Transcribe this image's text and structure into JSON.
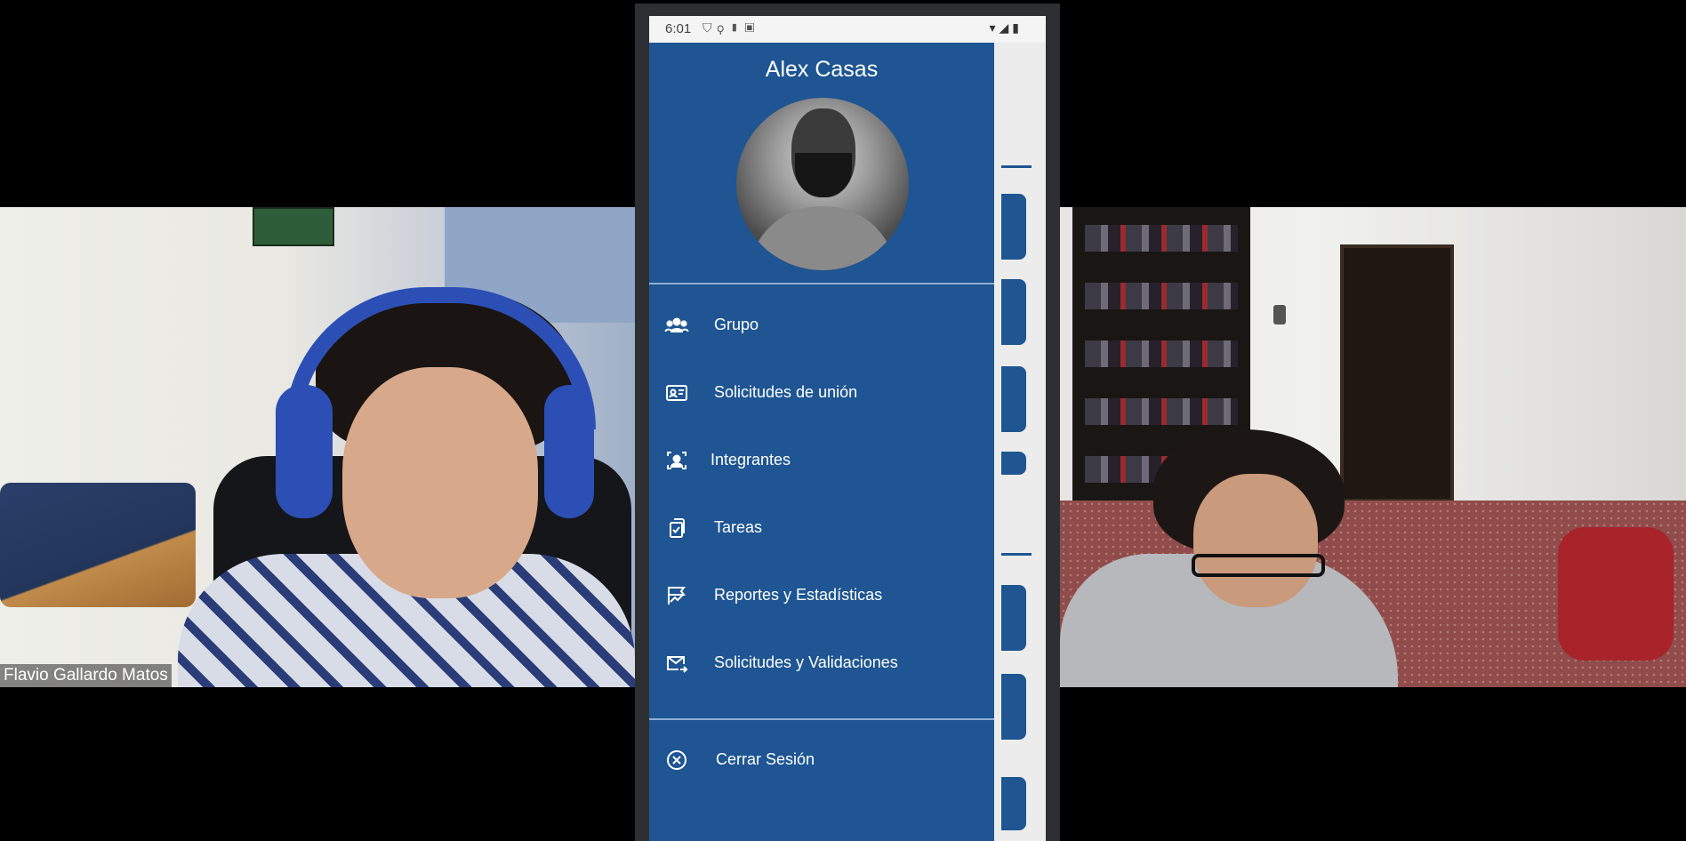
{
  "participants": {
    "left": {
      "name": "Flavio Gallardo Matos"
    },
    "right": {
      "name": ""
    }
  },
  "phone": {
    "status_bar": {
      "time": "6:01",
      "left_icons": [
        "shield-icon",
        "usb-icon",
        "sd-card-icon",
        "font-icon"
      ],
      "right_icons": [
        "wifi-icon",
        "signal-icon",
        "battery-icon"
      ]
    },
    "drawer": {
      "user_name": "Alex Casas",
      "accent_color": "#1e5592",
      "menu": [
        {
          "label": "Grupo",
          "icon": "group-icon"
        },
        {
          "label": "Solicitudes de unión",
          "icon": "id-card-icon"
        },
        {
          "label": "Integrantes",
          "icon": "member-icon"
        },
        {
          "label": "Tareas",
          "icon": "tasks-icon"
        },
        {
          "label": "Reportes y Estadísticas",
          "icon": "chart-icon"
        },
        {
          "label": "Solicitudes y Validaciones",
          "icon": "mail-icon"
        }
      ],
      "logout": {
        "label": "Cerrar Sesión",
        "icon": "close-circle-icon"
      }
    }
  }
}
